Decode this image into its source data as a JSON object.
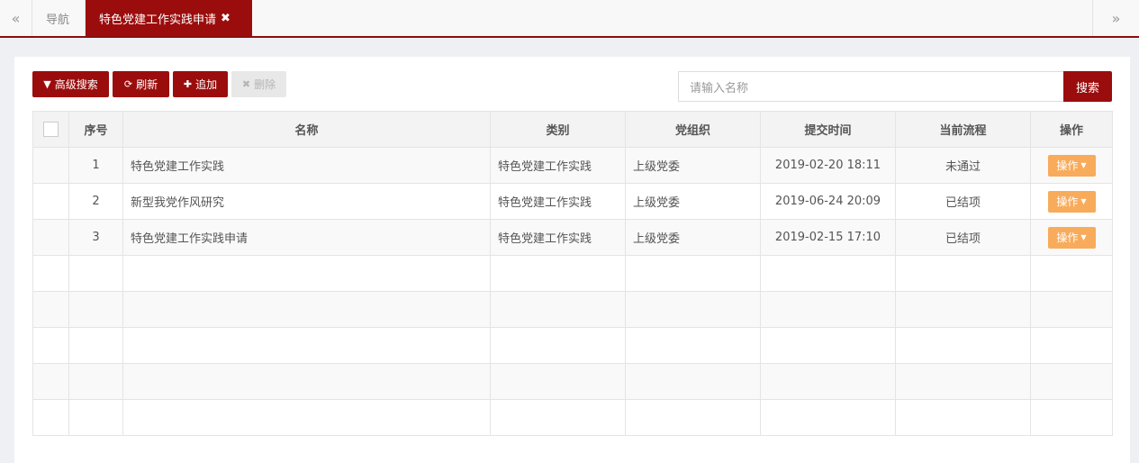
{
  "tabs": {
    "prev_icon": "«",
    "next_icon": "»",
    "home_label": "导航",
    "active_label": "特色党建工作实践申请",
    "close_icon": "✖"
  },
  "toolbar": {
    "advanced_search": {
      "icon": "▼",
      "label": "高级搜索"
    },
    "refresh": {
      "icon": "⟳",
      "label": "刷新"
    },
    "add": {
      "icon": "✚",
      "label": "追加"
    },
    "delete": {
      "icon": "✖",
      "label": "删除"
    }
  },
  "search": {
    "placeholder": "请输入名称",
    "button_label": "搜索"
  },
  "table": {
    "headers": {
      "index": "序号",
      "name": "名称",
      "category": "类别",
      "org": "党组织",
      "submit_time": "提交时间",
      "status": "当前流程",
      "action": "操作"
    },
    "rows": [
      {
        "index": "1",
        "name": "特色党建工作实践",
        "category": "特色党建工作实践",
        "org": "上级党委",
        "submit_time": "2019-02-20 18:11",
        "status": "未通过",
        "action": "操作"
      },
      {
        "index": "2",
        "name": "新型我党作风研究",
        "category": "特色党建工作实践",
        "org": "上级党委",
        "submit_time": "2019-06-24 20:09",
        "status": "已结项",
        "action": "操作"
      },
      {
        "index": "3",
        "name": "特色党建工作实践申请",
        "category": "特色党建工作实践",
        "org": "上级党委",
        "submit_time": "2019-02-15 17:10",
        "status": "已结项",
        "action": "操作"
      }
    ]
  },
  "colors": {
    "brand": "#9b0d0d",
    "action_button": "#f8ab5a"
  }
}
